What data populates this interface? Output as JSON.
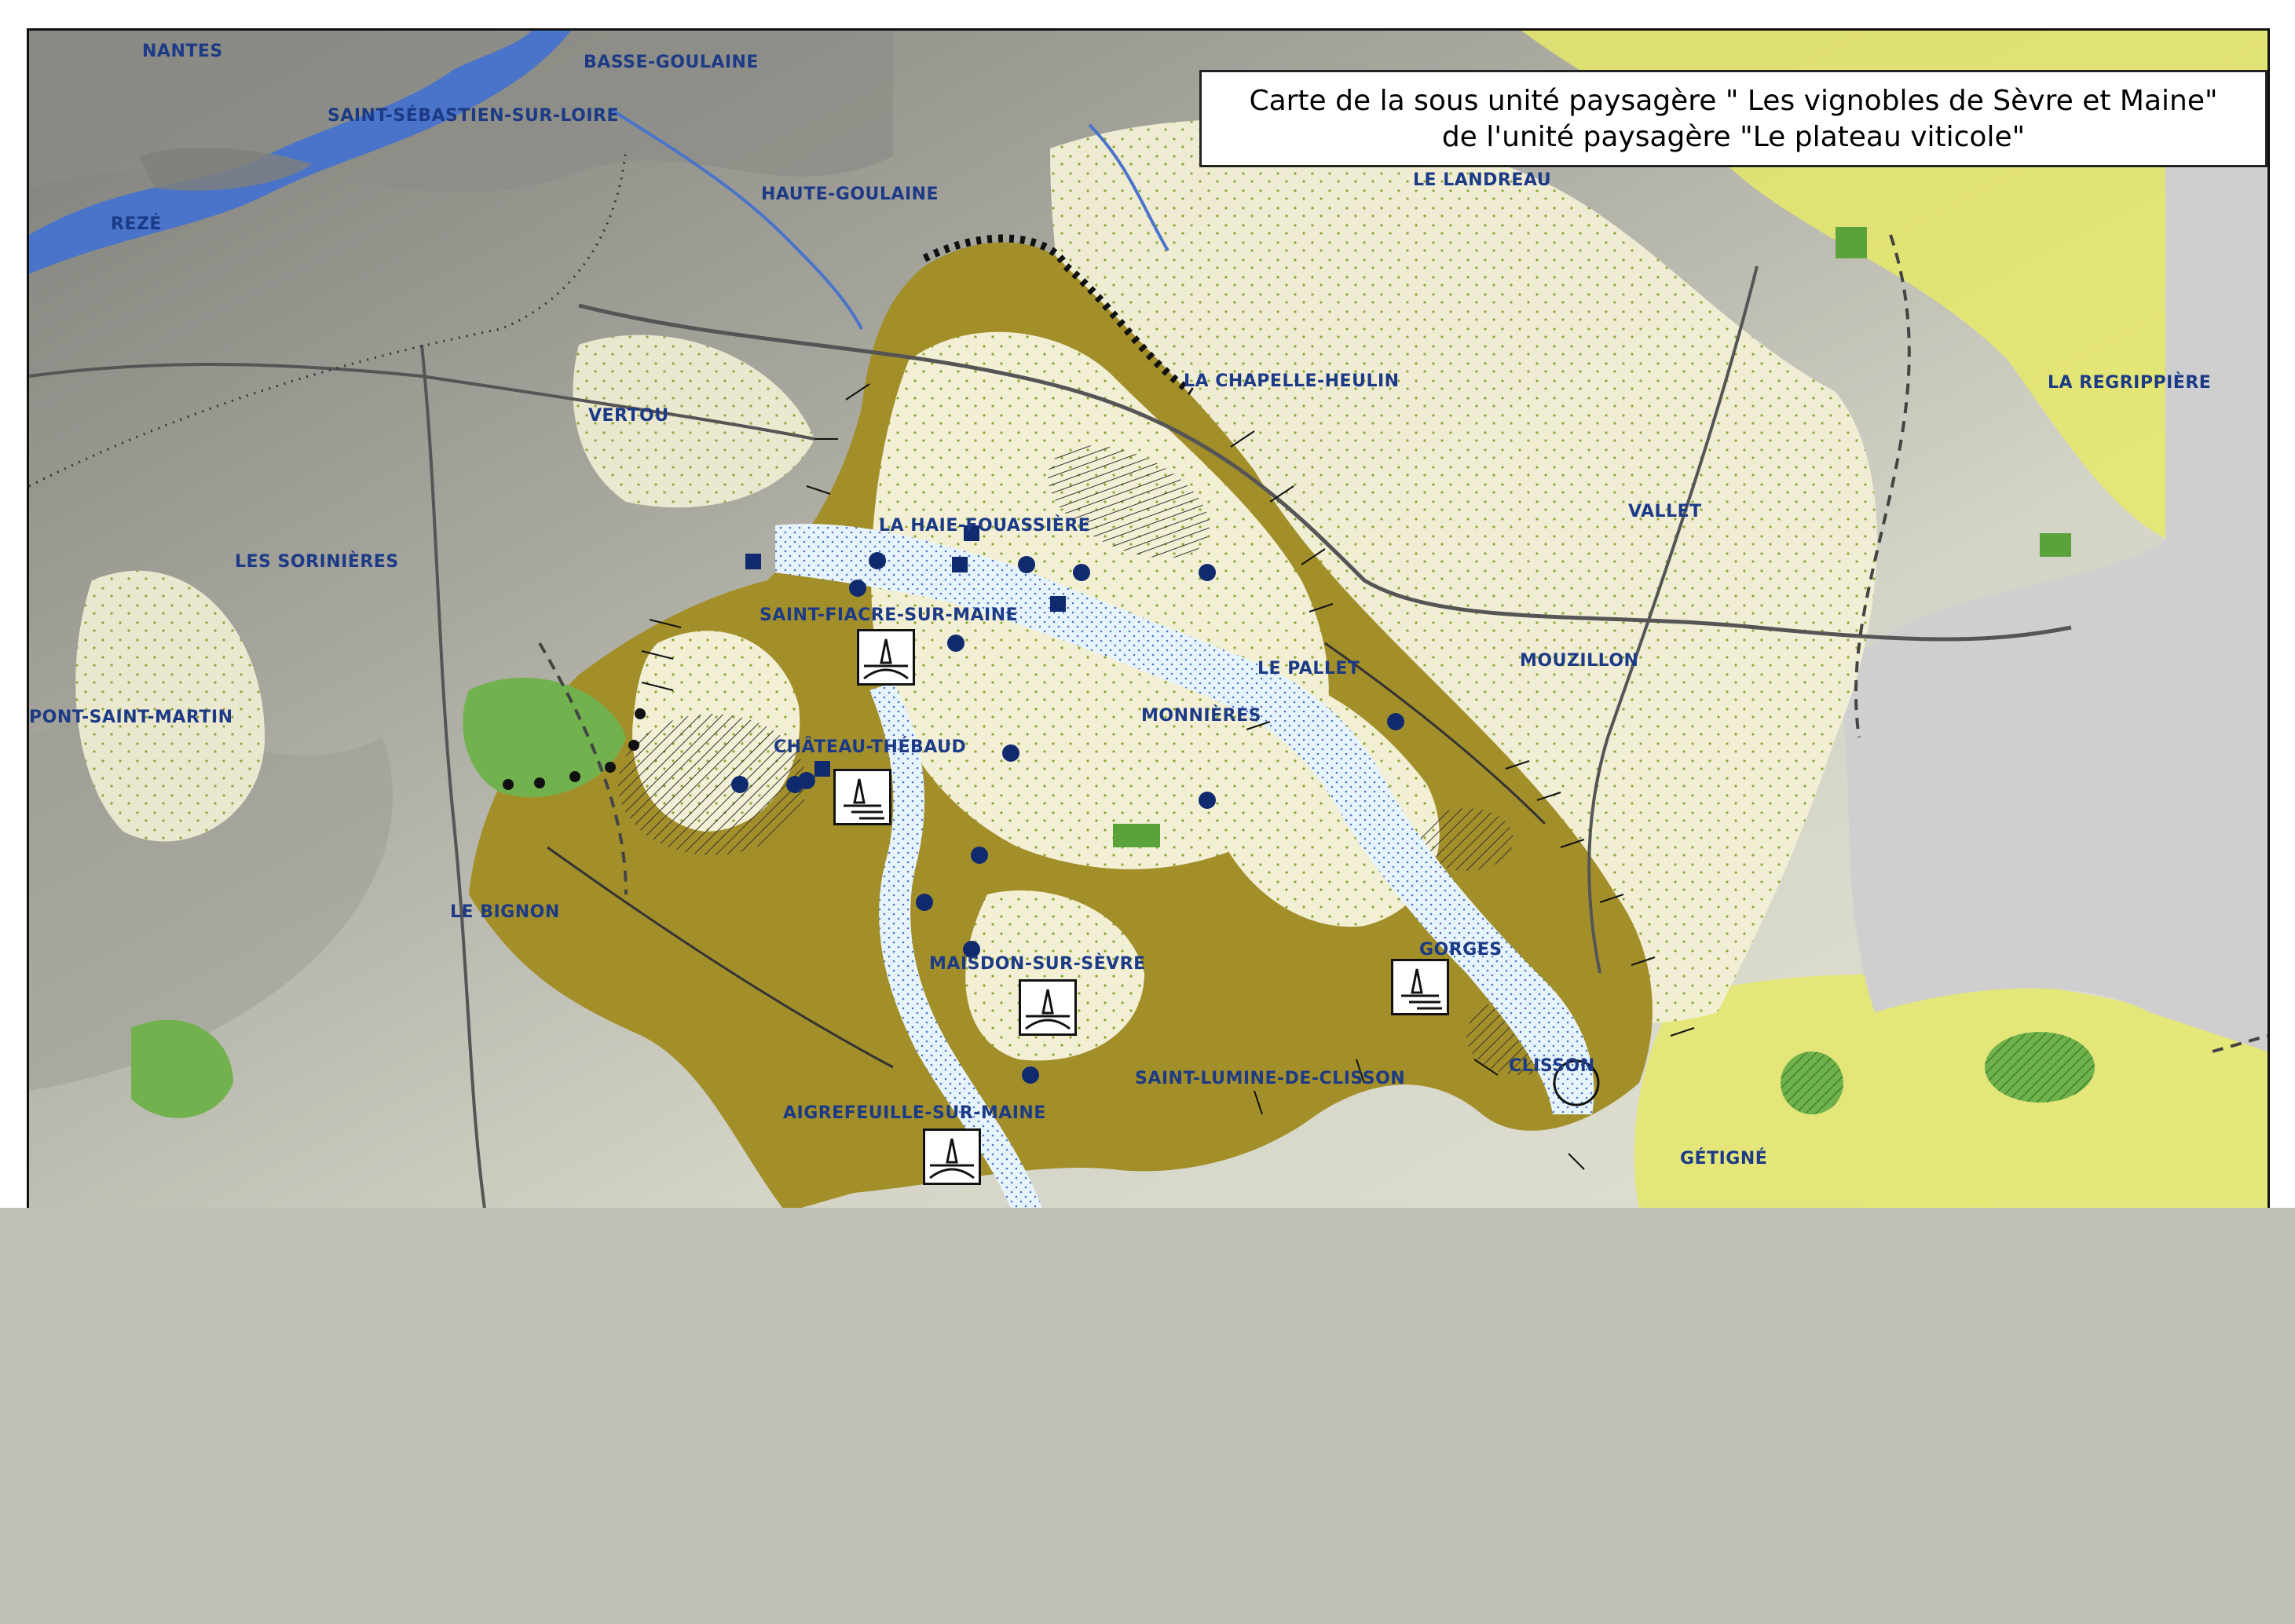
{
  "map": {
    "title_line1": "Carte de la sous unité paysagère \" Les vignobles de Sèvre et Maine\"",
    "title_line2": "de l'unité paysagère \"Le plateau viticole\"",
    "places": [
      {
        "id": "nantes",
        "label": "NANTES"
      },
      {
        "id": "basse-goulaine",
        "label": "BASSE-GOULAINE"
      },
      {
        "id": "saint-sebastien-sur-loire",
        "label": "SAINT-SÉBASTIEN-SUR-LOIRE"
      },
      {
        "id": "haute-goulaine",
        "label": "HAUTE-GOULAINE"
      },
      {
        "id": "reze",
        "label": "REZÉ"
      },
      {
        "id": "le-landreau",
        "label": "LE LANDREAU"
      },
      {
        "id": "la-chapelle-heulin",
        "label": "LA CHAPELLE-HEULIN"
      },
      {
        "id": "la-regrippiere",
        "label": "LA REGRIPPIÈRE"
      },
      {
        "id": "vertou",
        "label": "VERTOU"
      },
      {
        "id": "vallet",
        "label": "VALLET"
      },
      {
        "id": "la-haie-fouassiere",
        "label": "LA HAIE-FOUASSIÈRE"
      },
      {
        "id": "les-sorinieres",
        "label": "LES SORINIÈRES"
      },
      {
        "id": "saint-fiacre-sur-maine",
        "label": "SAINT-FIACRE-SUR-MAINE"
      },
      {
        "id": "le-pallet",
        "label": "LE PALLET"
      },
      {
        "id": "mouzillon",
        "label": "MOUZILLON"
      },
      {
        "id": "pont-saint-martin",
        "label": "PONT-SAINT-MARTIN"
      },
      {
        "id": "monnieres",
        "label": "MONNIÈRES"
      },
      {
        "id": "chateau-thebaud",
        "label": "CHÂTEAU-THÉBAUD"
      },
      {
        "id": "le-bignon",
        "label": "LE BIGNON"
      },
      {
        "id": "gorges",
        "label": "GORGES"
      },
      {
        "id": "maisdon-sur-sevre",
        "label": "MAISDON-SUR-SÈVRE"
      },
      {
        "id": "clisson",
        "label": "CLISSON"
      },
      {
        "id": "saint-lumine-de-clisson",
        "label": "SAINT-LUMINE-DE-CLISSON"
      },
      {
        "id": "aigrefeuille-sur-maine",
        "label": "AIGREFEUILLE-SUR-MAINE"
      },
      {
        "id": "getigne",
        "label": "GÉTIGNÉ"
      }
    ],
    "colors": {
      "unit_fill": "#a38f2a",
      "vineyard": "#ece7c8",
      "river": "#4a74c9",
      "river_valley": "#dff0fb",
      "label": "#1c3a86",
      "marker": "#0f2a6e",
      "woods": "#5aa23a",
      "yellow_zone": "#eeee55",
      "background": "#c0c0b8"
    },
    "icons": [
      "bridge-panorama-icon",
      "water-panorama-icon",
      "heritage-dot-icon",
      "heritage-square-icon",
      "view-arrow-icon"
    ]
  }
}
